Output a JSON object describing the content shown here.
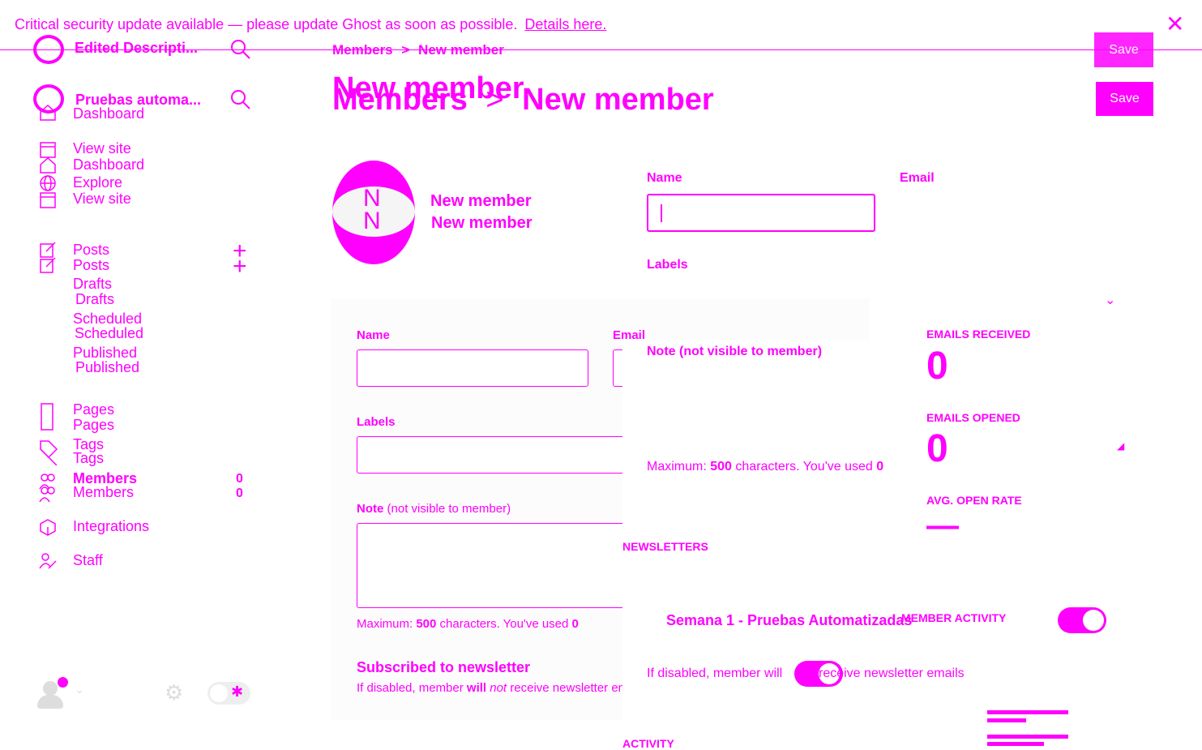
{
  "banner": {
    "message": "Critical security update available — please update Ghost as soon as possible.",
    "link": "Details here."
  },
  "sidebar": {
    "site_title_1": "Edited Descripti...",
    "site_title_2": "Pruebas automa...",
    "nav_top": [
      {
        "label": "Dashboard",
        "icon": "home-icon"
      },
      {
        "label": "View site",
        "icon": "window-icon"
      },
      {
        "label": "Dashboard",
        "icon": "home-icon"
      },
      {
        "label": "Explore",
        "icon": "globe-icon"
      },
      {
        "label": "View site",
        "icon": "window-icon"
      }
    ],
    "posts": {
      "label": "Posts",
      "label_dup": "Posts"
    },
    "drafts": {
      "label": "Drafts",
      "label_dup": "Drafts"
    },
    "scheduled": {
      "label": "Scheduled",
      "label_dup": "Scheduled"
    },
    "published": {
      "label": "Published",
      "label_dup": "Published"
    },
    "pages": {
      "label": "Pages",
      "label_dup": "Pages"
    },
    "tags": {
      "label": "Tags",
      "label_dup": "Tags"
    },
    "members": {
      "label": "Members",
      "label_dup": "Members",
      "count": "0",
      "count_dup": "0"
    },
    "integrations": {
      "label": "Integrations"
    },
    "staff": {
      "label": "Staff"
    }
  },
  "header": {
    "breadcrumb_parent": "Members",
    "breadcrumb_sep": ">",
    "breadcrumb_current": "New member",
    "title_overlay": "New member",
    "title_parent": "Members",
    "title_sep": ">",
    "title_current": "New member",
    "save_label": "Save",
    "save_label_2": "Save"
  },
  "member": {
    "initial": "N",
    "initial_dup": "N",
    "name_display": "New member",
    "name_display_dup": "New member"
  },
  "form_top": {
    "name_label": "Name",
    "email_label": "Email",
    "labels_label": "Labels",
    "note_label": "Note (not visible to member)",
    "max_chars_prefix": "Maximum:",
    "max_chars_num": "500",
    "max_chars_mid": "characters. You've used",
    "max_chars_used": "0",
    "newsletters_header": "NEWSLETTERS",
    "newsletter_name": "Semana 1 - Pruebas Automatizadas",
    "if_disabled_prefix": "If disabled, member will",
    "if_disabled_suffix": "receive newsletter emails",
    "activity_header": "ACTIVITY"
  },
  "form": {
    "name_label": "Name",
    "email_label": "Email",
    "labels_label": "Labels",
    "note_label_bold": "Note",
    "note_label_rest": "(not visible to member)",
    "max_chars_prefix": "Maximum:",
    "max_chars_num": "500",
    "max_chars_mid": "characters. You've used",
    "max_chars_used": "0",
    "subscribed_label": "Subscribed to newsletter",
    "if_disabled_1": "If disabled, member",
    "if_disabled_will": "will",
    "if_disabled_not": "not",
    "if_disabled_2": "receive newsletter emails"
  },
  "stats": {
    "emails_received_label": "EMAILS RECEIVED",
    "emails_received_value": "0",
    "emails_opened_label": "EMAILS OPENED",
    "emails_opened_value": "0",
    "avg_open_rate_label": "AVG. OPEN RATE",
    "avg_open_rate_value": "—",
    "member_activity_label": "MEMBER ACTIVITY"
  },
  "colors": {
    "accent": "#ff00ff",
    "background": "#ffffff"
  }
}
